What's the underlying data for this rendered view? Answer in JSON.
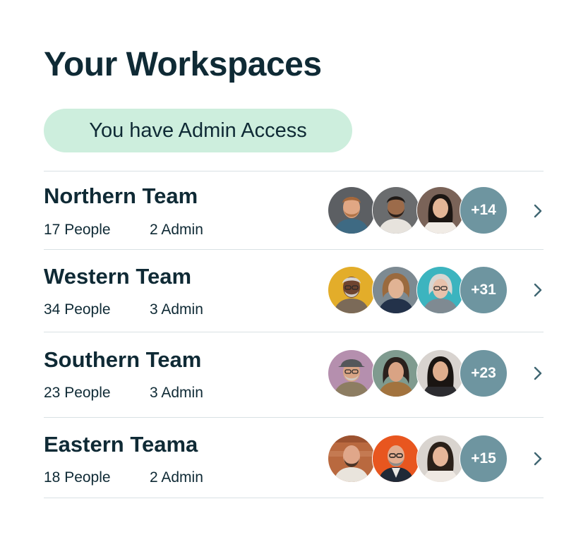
{
  "page": {
    "title": "Your Workspaces",
    "access_badge": "You have Admin Access"
  },
  "workspaces": [
    {
      "name": "Northern Team",
      "people": "17 People",
      "admins": "2 Admin",
      "more_count": "+14",
      "avatars": [
        "avatar-smiling-man-beard",
        "avatar-man-dark-beard",
        "avatar-smiling-woman"
      ]
    },
    {
      "name": "Western Team",
      "people": "34 People",
      "admins": "3 Admin",
      "more_count": "+31",
      "avatars": [
        "avatar-older-man-glasses",
        "avatar-woman-curly-hair",
        "avatar-older-woman-glasses"
      ]
    },
    {
      "name": "Southern Team",
      "people": "23 People",
      "admins": "3 Admin",
      "more_count": "+23",
      "avatars": [
        "avatar-man-cap-glasses",
        "avatar-woman-dark-hair",
        "avatar-smiling-woman"
      ]
    },
    {
      "name": "Eastern Teama",
      "people": "18 People",
      "admins": "2 Admin",
      "more_count": "+15",
      "avatars": [
        "avatar-bald-man-beard",
        "avatar-man-glasses-beard",
        "avatar-smiling-woman"
      ]
    }
  ],
  "colors": {
    "text": "#0f2a35",
    "badge_bg": "#cdeedd",
    "more_bg": "#6e95a0",
    "divider": "#d9e1e4",
    "chevron": "#3f6672"
  },
  "icons": {
    "row_action": "chevron-right-icon"
  }
}
